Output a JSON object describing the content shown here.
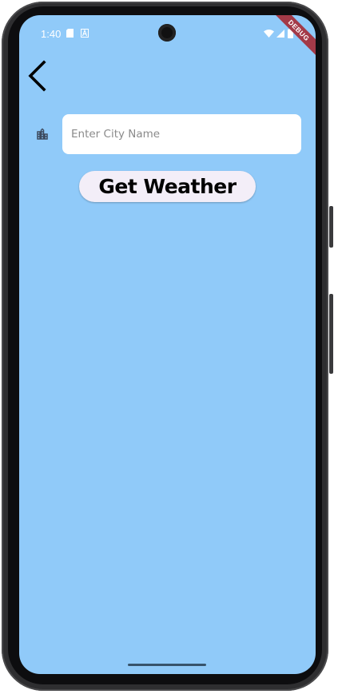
{
  "status_bar": {
    "time": "1:40",
    "icons": [
      "sd-card-icon",
      "accessibility-a-icon",
      "wifi-icon",
      "signal-icon",
      "battery-icon"
    ]
  },
  "debug_banner": "DEBUG",
  "app_bar": {
    "back_icon": "arrow-back-icon"
  },
  "search": {
    "leading_icon": "location-city-icon",
    "placeholder": "Enter City Name",
    "value": ""
  },
  "actions": {
    "get_weather_label": "Get Weather"
  },
  "colors": {
    "screen_background": "#90caf9",
    "input_background": "#ffffff",
    "button_background": "#f3eef8",
    "debug_ribbon": "#a33a48"
  }
}
